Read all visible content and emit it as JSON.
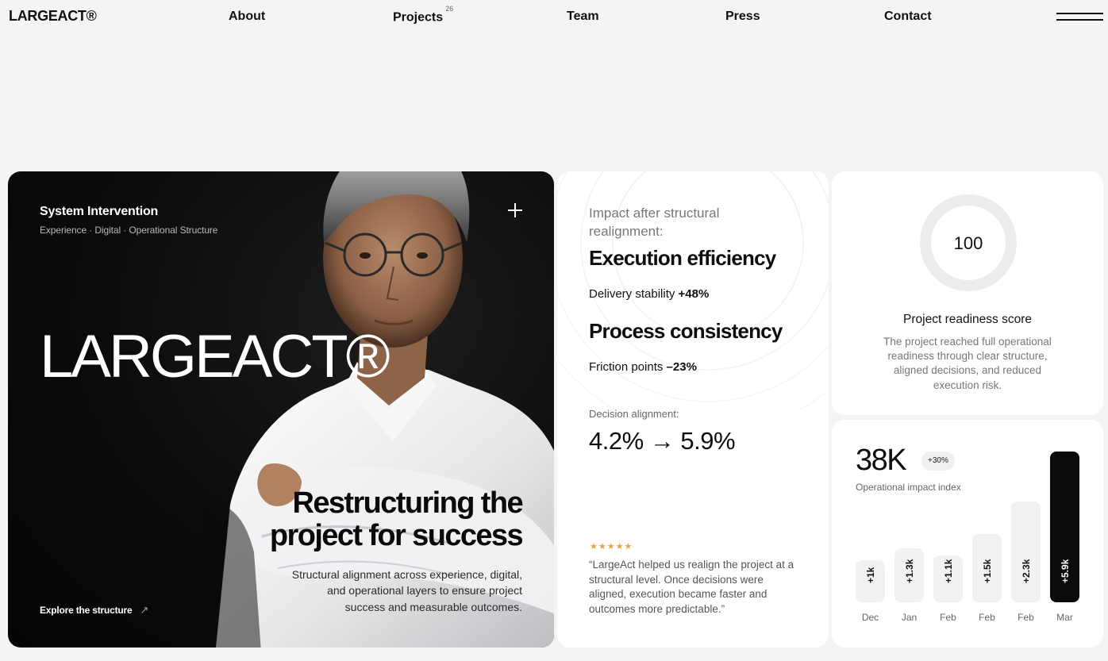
{
  "nav": {
    "logo": "LARGEACT®",
    "items": [
      {
        "label": "About"
      },
      {
        "label": "Projects",
        "count": "26"
      },
      {
        "label": "Team"
      },
      {
        "label": "Press"
      },
      {
        "label": "Contact"
      }
    ],
    "menu_icon": "hamburger-icon"
  },
  "hero": {
    "kicker": "System Intervention",
    "subtitle": "Experience · Digital · Operational Structure",
    "brand": "LARGEACT®",
    "headline": "Restructuring the project for success",
    "body": "Structural alignment across experience, digital, and operational layers to ensure project success and measurable outcomes.",
    "cta_label": "Explore the structure",
    "cta_icon": "arrow-up-right-icon",
    "plus_icon": "plus-icon"
  },
  "stats": {
    "intro": "Impact after structural realignment:",
    "metrics": [
      {
        "title": "Execution efficiency",
        "label": "Delivery stability",
        "value": "+48%"
      },
      {
        "title": "Process consistency",
        "label": "Friction points",
        "value": "–23%"
      }
    ],
    "decision_label": "Decision alignment:",
    "decision_value": "4.2% → 5.9%",
    "rating": "★★★★★",
    "quote": "“LargeAct helped us realign the project at a structural level. Once decisions were aligned, execution became faster and outcomes more predictable.”"
  },
  "readiness": {
    "score": "100",
    "title": "Project readiness score",
    "description": "The project reached full operational readiness through clear structure, aligned decisions, and reduced execution risk."
  },
  "impact": {
    "value": "38K",
    "badge": "+30%",
    "label": "Operational impact index",
    "accent_color": "#0b0b0b",
    "bar_color": "#f2f2f2",
    "bars": [
      {
        "label": "+1k",
        "month": "Dec",
        "level": 0.28
      },
      {
        "label": "+1.3k",
        "month": "Jan",
        "level": 0.36
      },
      {
        "label": "+1.1k",
        "month": "Feb",
        "level": 0.31
      },
      {
        "label": "+1.5k",
        "month": "Feb",
        "level": 0.45
      },
      {
        "label": "+2.3k",
        "month": "Feb",
        "level": 0.67
      },
      {
        "label": "+5.9k",
        "month": "Mar",
        "level": 1.0,
        "highlight": true
      }
    ]
  }
}
